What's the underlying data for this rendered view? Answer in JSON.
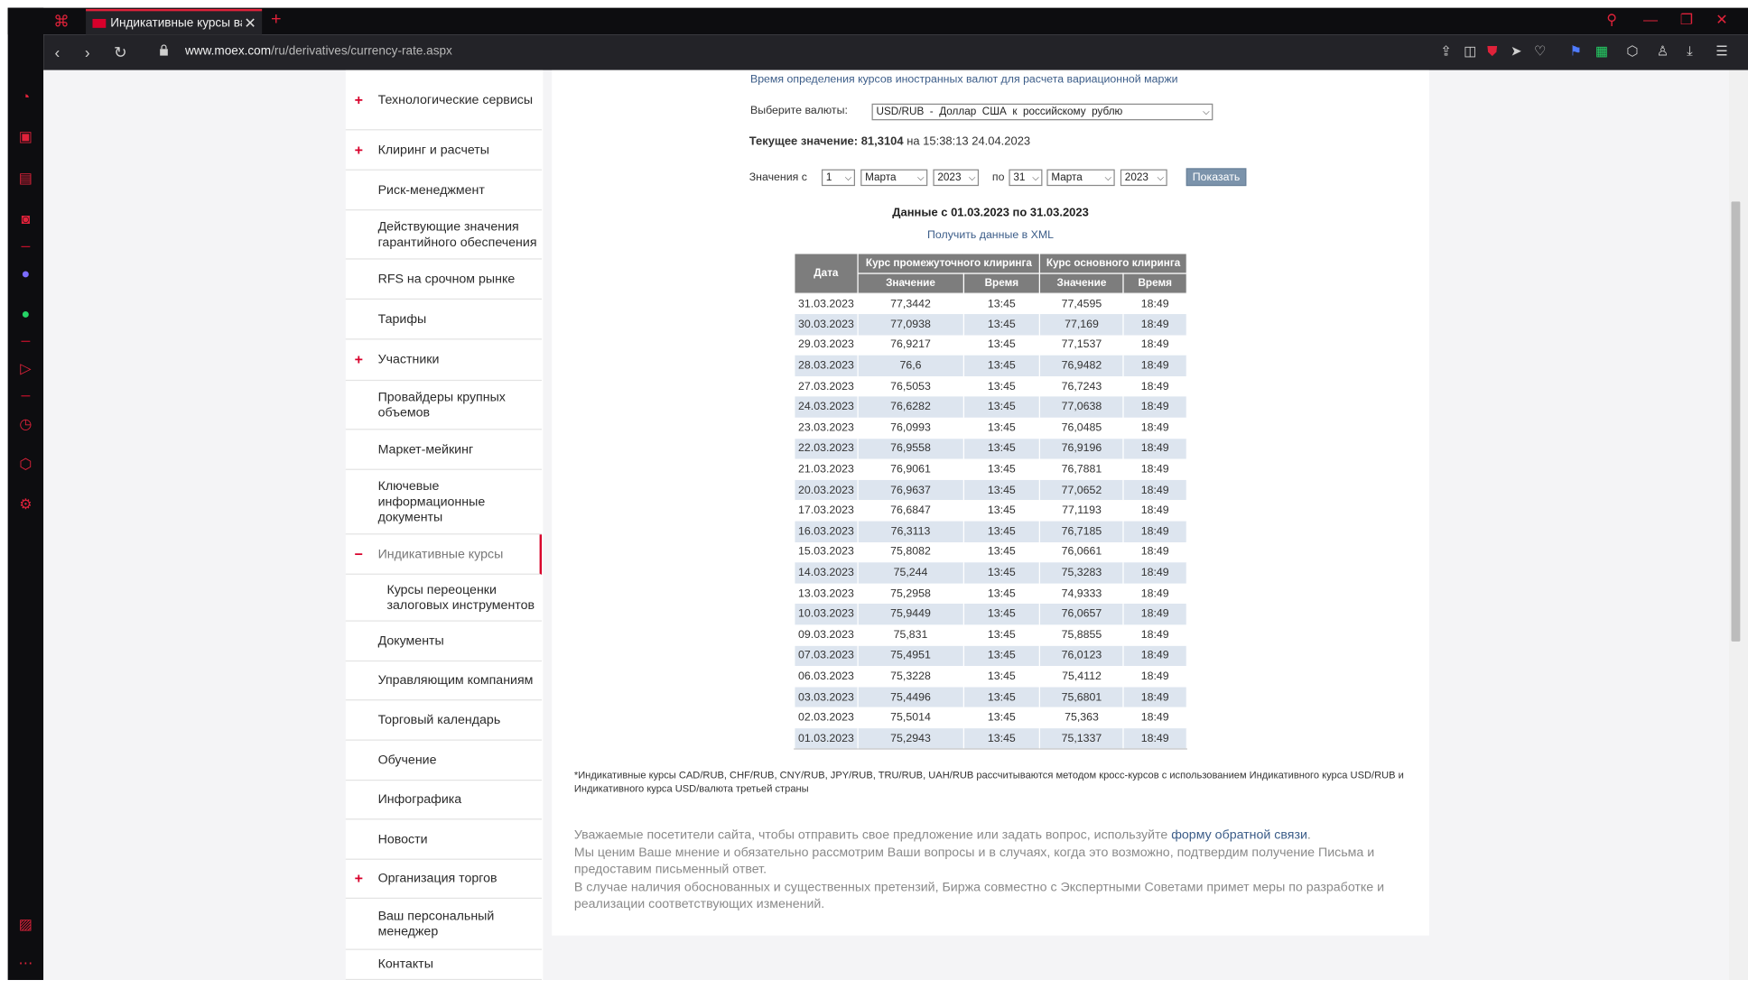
{
  "browser": {
    "tab_title": "Индикативные курсы валю",
    "url_host": "www.moex.com",
    "url_path": "/ru/derivatives/currency-rate.aspx"
  },
  "menu": {
    "items": [
      {
        "label": "Технологические сервисы",
        "plus": "+"
      },
      {
        "label": "Клиринг и расчеты",
        "plus": "+"
      },
      {
        "label": "Риск-менеджмент",
        "plus": ""
      },
      {
        "label": "Действующие значения гарантийного обеспечения",
        "plus": ""
      },
      {
        "label": "RFS на срочном рынке",
        "plus": ""
      },
      {
        "label": "Тарифы",
        "plus": ""
      },
      {
        "label": "Участники",
        "plus": "+"
      },
      {
        "label": "Провайдеры крупных объемов",
        "plus": ""
      },
      {
        "label": "Маркет-мейкинг",
        "plus": ""
      },
      {
        "label": "Ключевые информационные документы",
        "plus": ""
      },
      {
        "label": "Индикативные курсы",
        "plus": "−"
      },
      {
        "label": "Курсы переоценки залоговых инструментов",
        "plus": ""
      },
      {
        "label": "Документы",
        "plus": ""
      },
      {
        "label": "Управляющим компаниям",
        "plus": ""
      },
      {
        "label": "Торговый календарь",
        "plus": ""
      },
      {
        "label": "Обучение",
        "plus": ""
      },
      {
        "label": "Инфографика",
        "plus": ""
      },
      {
        "label": "Новости",
        "plus": ""
      },
      {
        "label": "Организация торгов",
        "plus": "+"
      },
      {
        "label": "Ваш персональный менеджер",
        "plus": ""
      },
      {
        "label": "Контакты",
        "plus": ""
      }
    ]
  },
  "form": {
    "top_note": "Время определения курсов иностранных валют для расчета вариационной маржи",
    "currency_label": "Выберите валюты:",
    "currency_value": "USD/RUB  -  Доллар  США  к  российскому  рублю",
    "current_label": "Текущее значение:",
    "current_value": "81,3104",
    "current_suffix": "на 15:38:13 24.04.2023",
    "from_label": "Значения с",
    "from_day": "1",
    "from_month": "Марта",
    "from_year": "2023",
    "to_label": "по",
    "to_day": "31",
    "to_month": "Марта",
    "to_year": "2023",
    "show_button": "Показать"
  },
  "results": {
    "title": "Данные с 01.03.2023 по 31.03.2023",
    "xml_link": "Получить данные в XML",
    "headers": {
      "date": "Дата",
      "intermediate": "Курс промежуточного клиринга",
      "main": "Курс основного клиринга",
      "value": "Значение",
      "time": "Время"
    },
    "rows": [
      [
        "31.03.2023",
        "77,3442",
        "13:45",
        "77,4595",
        "18:49"
      ],
      [
        "30.03.2023",
        "77,0938",
        "13:45",
        "77,169",
        "18:49"
      ],
      [
        "29.03.2023",
        "76,9217",
        "13:45",
        "77,1537",
        "18:49"
      ],
      [
        "28.03.2023",
        "76,6",
        "13:45",
        "76,9482",
        "18:49"
      ],
      [
        "27.03.2023",
        "76,5053",
        "13:45",
        "76,7243",
        "18:49"
      ],
      [
        "24.03.2023",
        "76,6282",
        "13:45",
        "77,0638",
        "18:49"
      ],
      [
        "23.03.2023",
        "76,0993",
        "13:45",
        "76,0485",
        "18:49"
      ],
      [
        "22.03.2023",
        "76,9558",
        "13:45",
        "76,9196",
        "18:49"
      ],
      [
        "21.03.2023",
        "76,9061",
        "13:45",
        "76,7881",
        "18:49"
      ],
      [
        "20.03.2023",
        "76,9637",
        "13:45",
        "77,0652",
        "18:49"
      ],
      [
        "17.03.2023",
        "76,6847",
        "13:45",
        "77,1193",
        "18:49"
      ],
      [
        "16.03.2023",
        "76,3113",
        "13:45",
        "76,7185",
        "18:49"
      ],
      [
        "15.03.2023",
        "75,8082",
        "13:45",
        "76,0661",
        "18:49"
      ],
      [
        "14.03.2023",
        "75,244",
        "13:45",
        "75,3283",
        "18:49"
      ],
      [
        "13.03.2023",
        "75,2958",
        "13:45",
        "74,9333",
        "18:49"
      ],
      [
        "10.03.2023",
        "75,9449",
        "13:45",
        "76,0657",
        "18:49"
      ],
      [
        "09.03.2023",
        "75,831",
        "13:45",
        "75,8855",
        "18:49"
      ],
      [
        "07.03.2023",
        "75,4951",
        "13:45",
        "76,0123",
        "18:49"
      ],
      [
        "06.03.2023",
        "75,3228",
        "13:45",
        "75,4112",
        "18:49"
      ],
      [
        "03.03.2023",
        "75,4496",
        "13:45",
        "75,6801",
        "18:49"
      ],
      [
        "02.03.2023",
        "75,5014",
        "13:45",
        "75,363",
        "18:49"
      ],
      [
        "01.03.2023",
        "75,2943",
        "13:45",
        "75,1337",
        "18:49"
      ]
    ]
  },
  "footnote": "*Индикативные курсы CAD/RUB, CHF/RUB, CNY/RUB, JPY/RUB, TRU/RUB, UAH/RUB рассчитываются методом кросс-курсов с использованием Индикативного курса USD/RUB и Индикативного курса USD/валюта третьей страны",
  "feedback": {
    "line1_pre": "Уважаемые посетители сайта, чтобы отправить свое предложение или задать вопрос, используйте ",
    "link": "форму обратной связи",
    "line1_post": ".",
    "line2": "Мы ценим Ваше мнение и обязательно рассмотрим Ваши вопросы и в случаях, когда это возможно, подтвердим получение Письма и предоставим письменный ответ.",
    "line3": "В случае наличия обоснованных и существенных претензий, Биржа совместно с Экспертными Советами примет меры по разработке и реализации соответствующих изменений."
  },
  "colors": {
    "accent": "#d8002b",
    "chrome_dark": "#0d0d10",
    "table_header": "#7d7d7d",
    "row_stripe": "#dde5ef",
    "link": "#3b5c88"
  }
}
